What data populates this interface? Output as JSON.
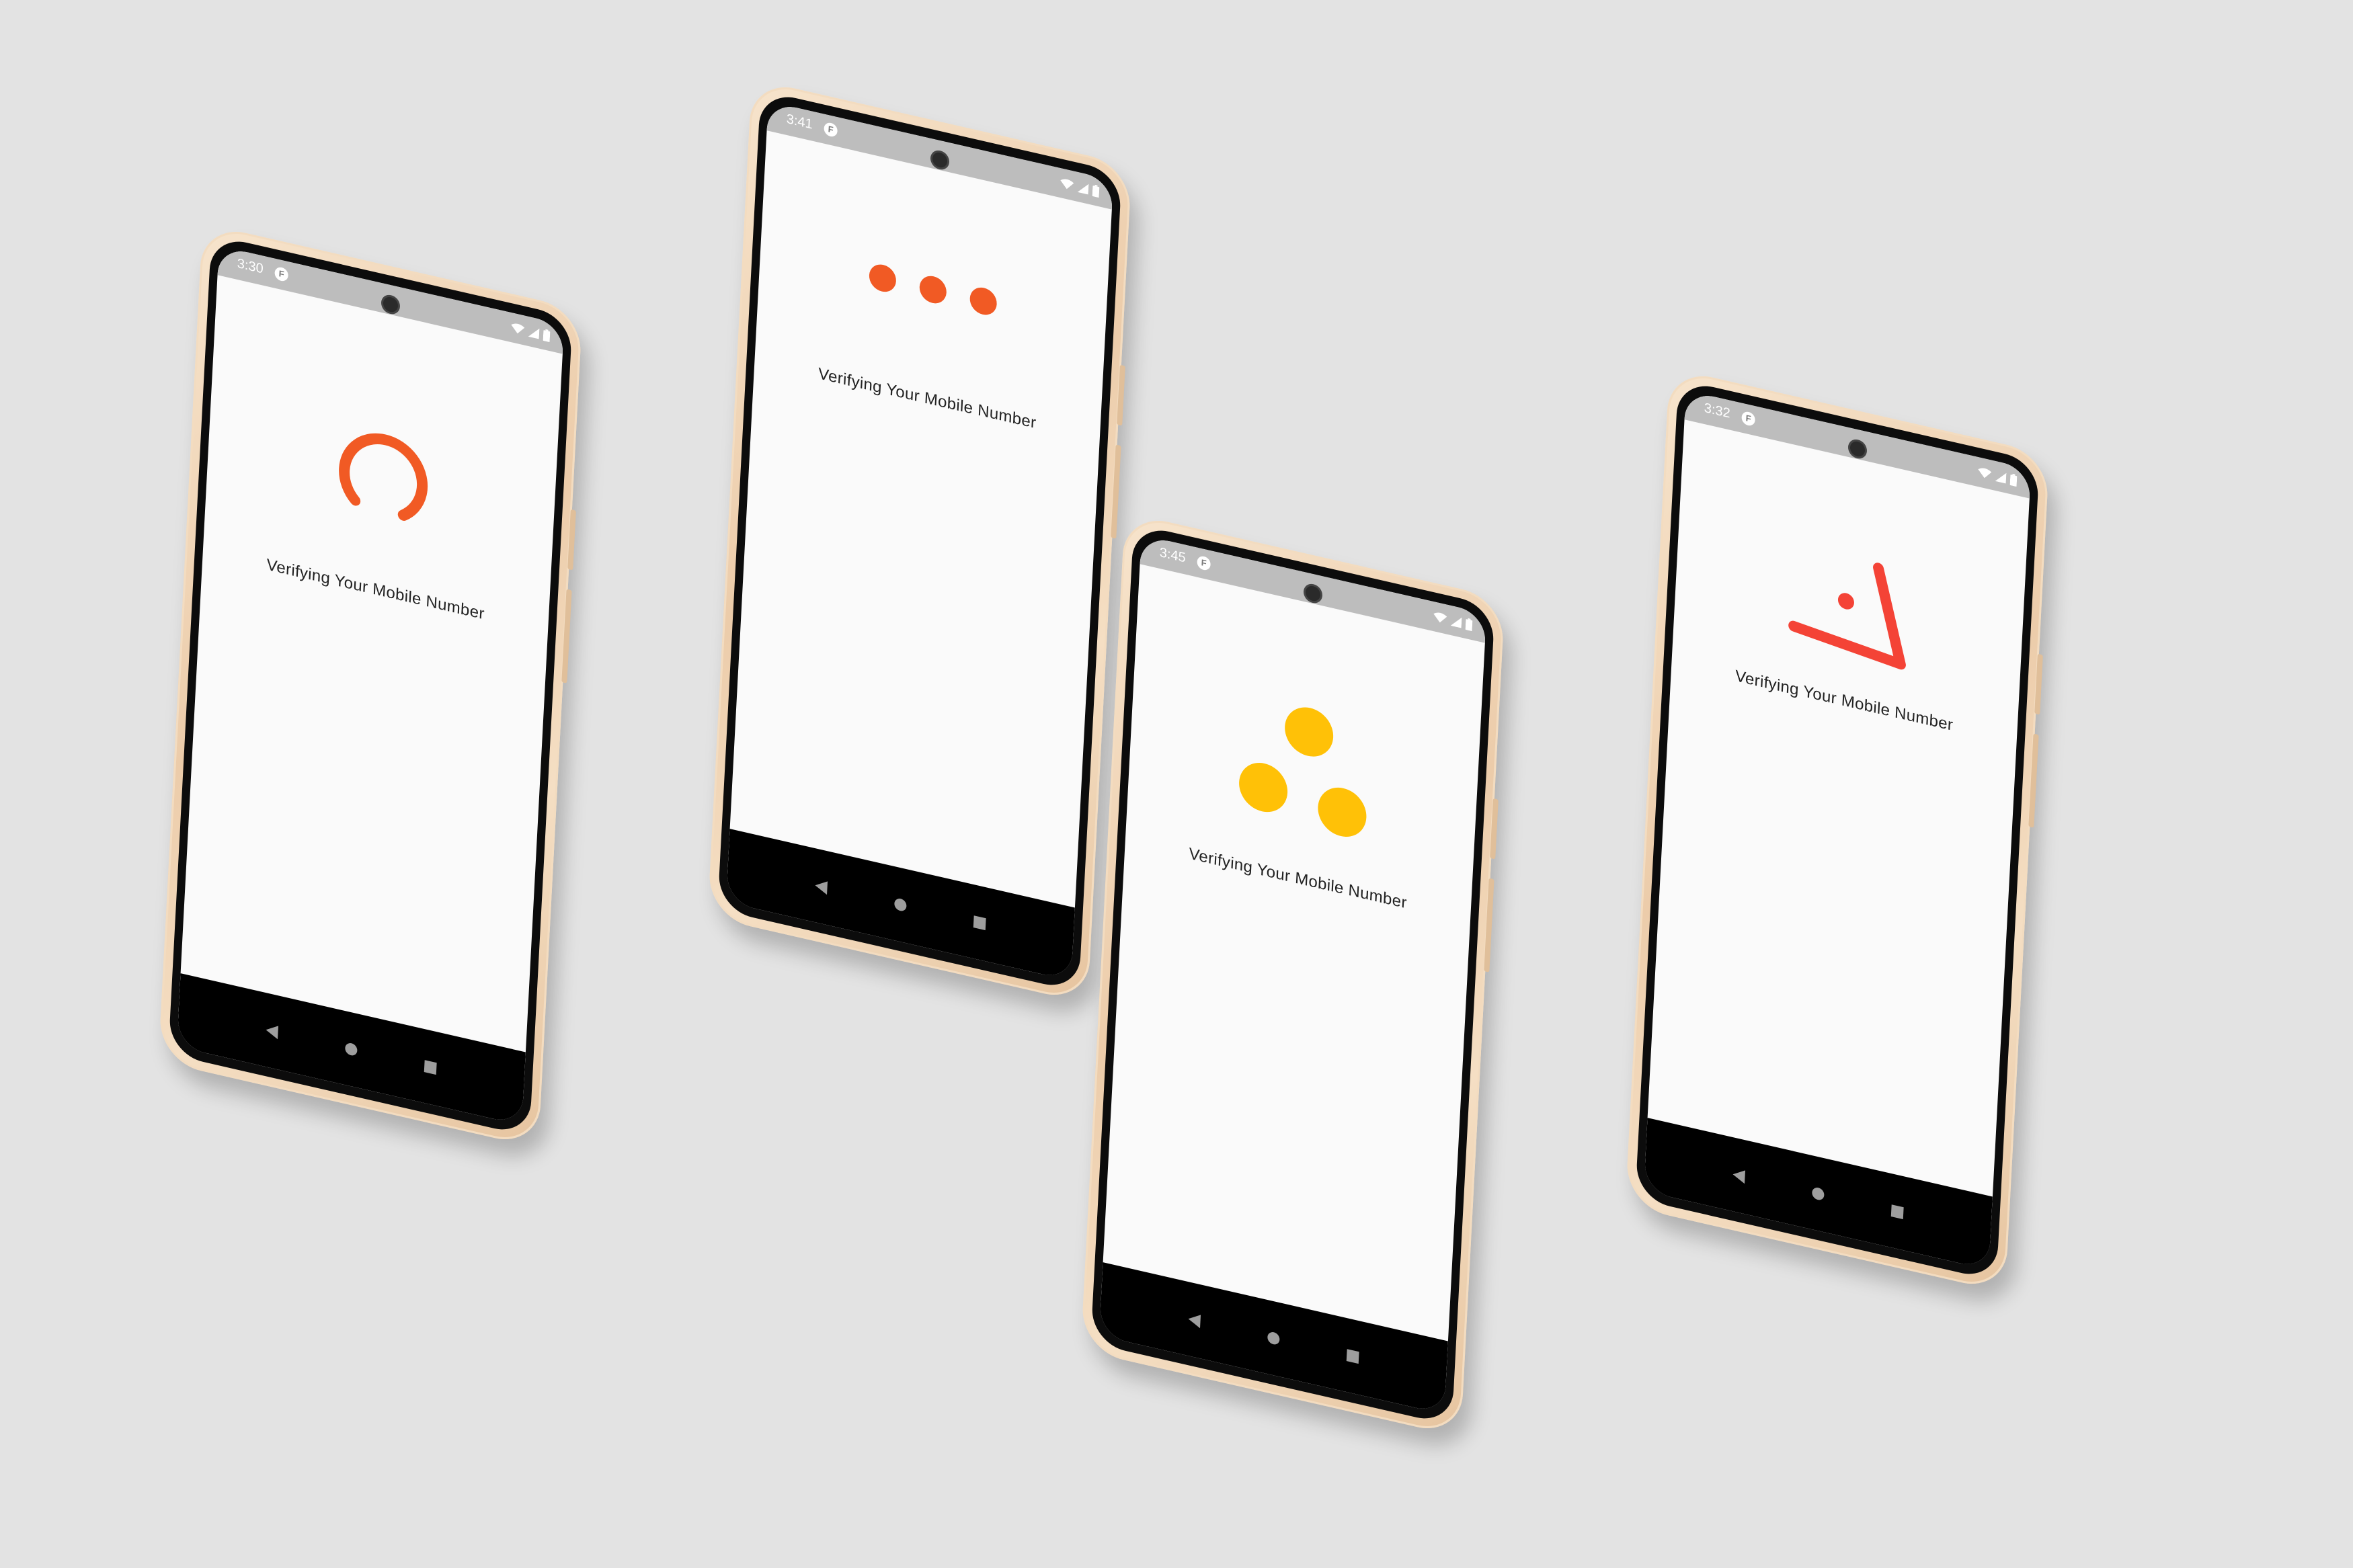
{
  "scene": {
    "background": "#e3e3e3",
    "frame_color": "gold-beige"
  },
  "common": {
    "message": "Verifying Your Mobile Number",
    "app_icon_letter": "F",
    "status_bar_color": "#bdbdbd",
    "screen_color": "#fafafa"
  },
  "phones": [
    {
      "id": "phone-1",
      "status_time": "3:30",
      "loader": "arc-spinner",
      "loader_color": "#f15a24"
    },
    {
      "id": "phone-2",
      "status_time": "3:41",
      "loader": "three-dots-horizontal",
      "loader_color": "#f15a24"
    },
    {
      "id": "phone-3",
      "status_time": "3:45",
      "loader": "three-dots-triangle",
      "loader_color": "#ffc107"
    },
    {
      "id": "phone-4",
      "status_time": "3:32",
      "loader": "check-arrow-dot",
      "loader_color": "#f44336"
    }
  ],
  "status_icons": [
    "wifi-icon",
    "signal-icon",
    "battery-icon"
  ],
  "nav_icons": [
    "back-icon",
    "home-icon",
    "recents-icon"
  ]
}
